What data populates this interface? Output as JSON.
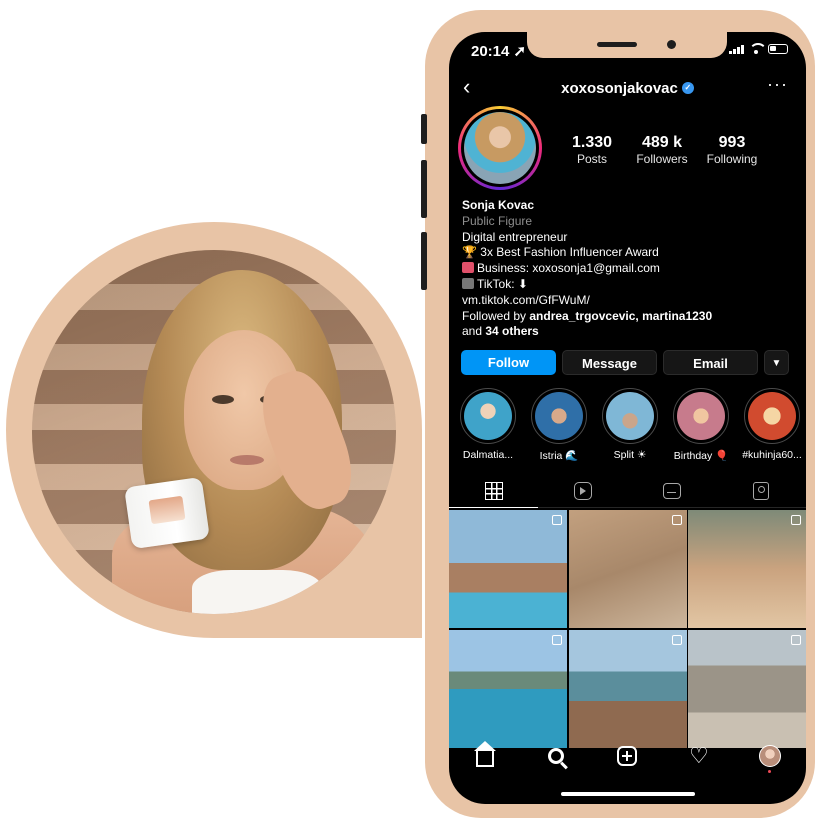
{
  "status": {
    "time": "20:14 ➚"
  },
  "profile": {
    "username": "xoxosonjakovac",
    "stats": [
      {
        "num": "1.330",
        "label": "Posts"
      },
      {
        "num": "489 k",
        "label": "Followers"
      },
      {
        "num": "993",
        "label": "Following"
      }
    ],
    "name": "Sonja Kovac",
    "category": "Public Figure",
    "bio_lines": [
      "Digital entrepreneur",
      "🏆 3x Best Fashion Influencer Award",
      "Business: xoxosonja1@gmail.com",
      "TikTok: ⬇",
      "vm.tiktok.com/GfFWuM/"
    ],
    "followed_by_prefix": "Followed by",
    "followed_by_users": "andrea_trgovcevic, martina1230",
    "followed_by_and": "and",
    "followed_by_others": "34 others"
  },
  "buttons": {
    "follow": "Follow",
    "message": "Message",
    "email": "Email",
    "more": "▼"
  },
  "highlights": [
    {
      "label": "Dalmatia...",
      "color": "#3fa3c9"
    },
    {
      "label": "Istria 🌊",
      "color": "#2f6fa8"
    },
    {
      "label": "Split ☀",
      "color": "#7fb7d6"
    },
    {
      "label": "Birthday 🎈",
      "color": "#c77b8c"
    },
    {
      "label": "#kuhinja60...",
      "color": "#d14b2f"
    }
  ],
  "tab_icons": [
    "grid-icon",
    "reels-icon",
    "igtv-icon",
    "tagged-icon"
  ],
  "posts": [
    {
      "color": "#6c90b0"
    },
    {
      "color": "#b59476"
    },
    {
      "color": "#c8a07a"
    },
    {
      "color": "#4a8fb4"
    },
    {
      "color": "#5a8fa0"
    },
    {
      "color": "#9a9a94"
    }
  ],
  "nav_icons": [
    "home-icon",
    "search-icon",
    "add-icon",
    "heart-icon",
    "profile-icon"
  ]
}
